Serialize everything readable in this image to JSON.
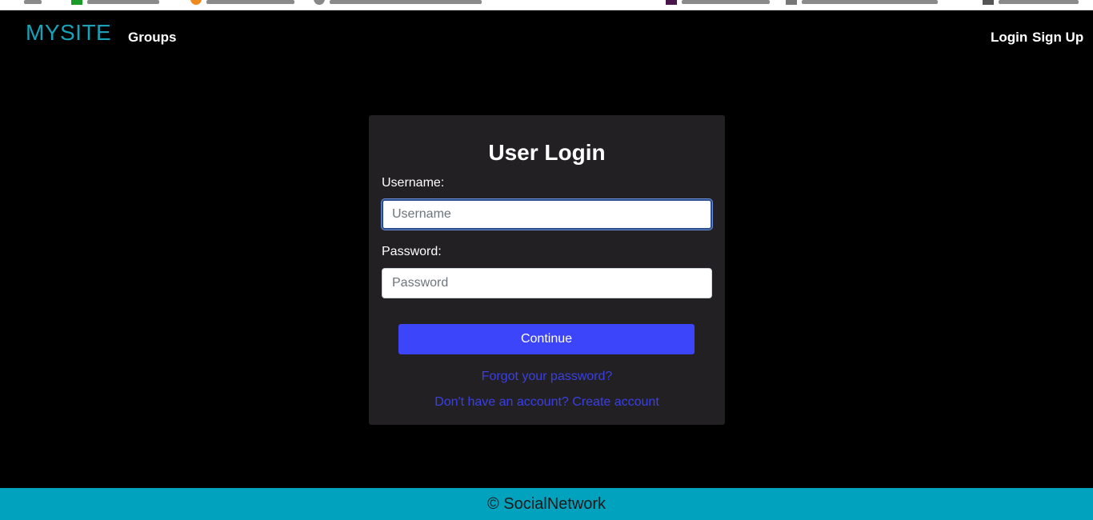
{
  "nav": {
    "brand": "MYSITE",
    "groups": "Groups",
    "login": "Login",
    "signup": "Sign Up"
  },
  "login_form": {
    "title": "User Login",
    "username_label": "Username:",
    "username_placeholder": "Username",
    "username_value": "",
    "password_label": "Password:",
    "password_placeholder": "Password",
    "password_value": "",
    "continue_label": "Continue",
    "forgot_link": "Forgot your password?",
    "create_link": "Don't have an account? Create account"
  },
  "footer": {
    "text": "© SocialNetwork"
  },
  "colors": {
    "brand": "#17a2b8",
    "card_bg": "#222022",
    "button": "#3d45fb",
    "link": "#3a3fe6",
    "footer_bg": "#00a2be"
  }
}
